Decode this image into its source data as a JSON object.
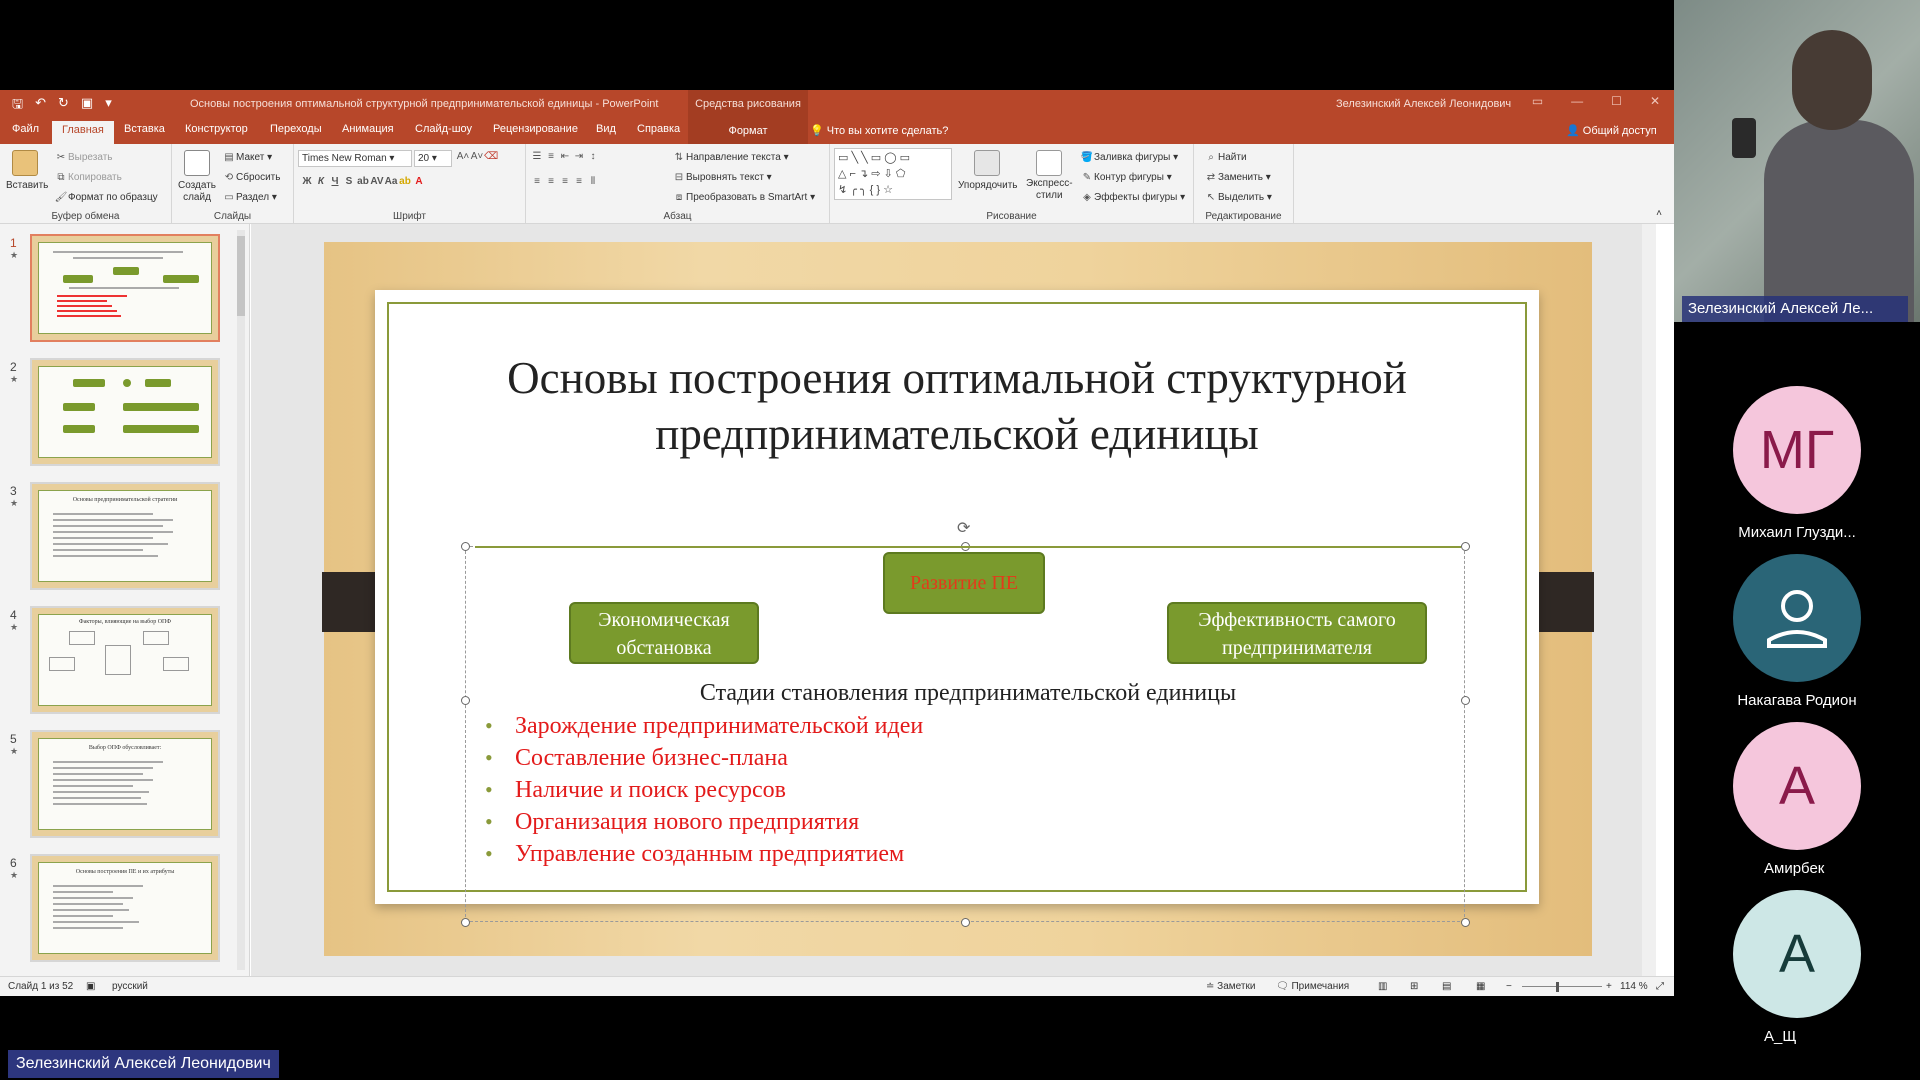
{
  "window": {
    "doc_title": "Основы построения оптимальной структурной предпринимательской единицы  -  PowerPoint",
    "context_title": "Средства рисования",
    "user_name": "Зелезинский Алексей Леонидович"
  },
  "tabs": {
    "file": "Файл",
    "home": "Главная",
    "insert": "Вставка",
    "design": "Конструктор",
    "transitions": "Переходы",
    "animation": "Анимация",
    "slideshow": "Слайд-шоу",
    "review": "Рецензирование",
    "view": "Вид",
    "help": "Справка",
    "format": "Формат",
    "tellme": "Что вы хотите сделать?",
    "share": "Общий доступ"
  },
  "ribbon": {
    "paste": "Вставить",
    "cut": "Вырезать",
    "copy": "Копировать",
    "format_painter": "Формат по образцу",
    "clipboard": "Буфер обмена",
    "new_slide_1": "Создать",
    "new_slide_2": "слайд",
    "layout": "Макет",
    "reset": "Сбросить",
    "section": "Раздел",
    "slides": "Слайды",
    "font_name": "Times New Roman",
    "font_size": "20",
    "font": "Шрифт",
    "text_dir": "Направление текста",
    "align_text": "Выровнять текст",
    "smartart": "Преобразовать в SmartArt",
    "paragraph": "Абзац",
    "arrange": "Упорядочить",
    "quick_1": "Экспресс-",
    "quick_2": "стили",
    "fill": "Заливка фигуры",
    "outline": "Контур фигуры",
    "effects": "Эффекты фигуры",
    "drawing": "Рисование",
    "find": "Найти",
    "replace": "Заменить",
    "select": "Выделить",
    "editing": "Редактирование"
  },
  "thumbnails": [
    "1",
    "2",
    "3",
    "4",
    "5",
    "6"
  ],
  "thumb_titles": {
    "t3": "Основы предпринимательской стратегии",
    "t4": "Факторы, влияющие на выбор ОПФ",
    "t5": "Выбор ОПФ обусловливает:",
    "t6": "Основы построения ПЕ и их атрибуты"
  },
  "slide": {
    "title": "Основы построения оптимальной структурной предпринимательской единицы",
    "box_center": "Развитие ПЕ",
    "box_left": "Экономическая обстановка",
    "box_right": "Эффективность самого предпринимателя",
    "subtitle": "Стадии становления предпринимательской единицы",
    "bullets": [
      "Зарождение предпринимательской идеи",
      "Составление бизнес-плана",
      "Наличие  и поиск ресурсов",
      "Организация нового предприятия",
      "Управление созданным предприятием"
    ]
  },
  "status": {
    "slide_of": "Слайд 1 из 52",
    "language": "русский",
    "notes": "Заметки",
    "comments": "Примечания",
    "zoom": "114 %"
  },
  "video": {
    "presenter_label": "Зелезинский Алексей Ле...",
    "participants": [
      {
        "initials": "МГ",
        "name": "Михаил Глузди...",
        "bg": "#f5c6dc",
        "fg": "#8a1a4a"
      },
      {
        "initials": "",
        "name": "Накагава Родион",
        "bg": "#2a6577",
        "fg": "#ffffff"
      },
      {
        "initials": "А",
        "name": "Амирбек",
        "bg": "#f5c6dc",
        "fg": "#8a1a4a"
      },
      {
        "initials": "А",
        "name": "А_Щ",
        "bg": "#cde7e6",
        "fg": "#163b3a"
      }
    ],
    "bottom_name": "Зелезинский Алексей Леонидович"
  },
  "colors": {
    "accent": "#b7472a",
    "slide_green": "#7a9a2d",
    "bullet_red": "#e31b1b"
  }
}
